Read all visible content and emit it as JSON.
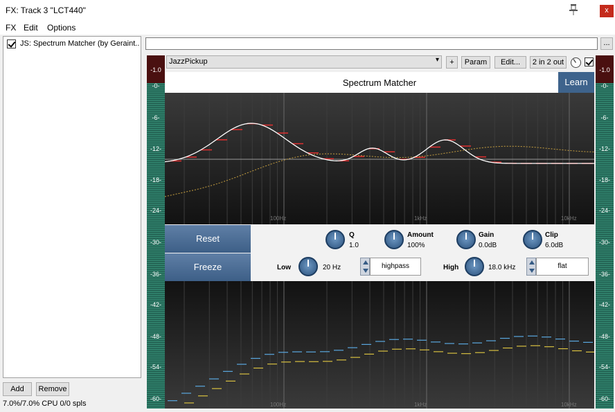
{
  "window": {
    "title": "FX: Track 3 \"LCT440\"",
    "close_glyph": "x"
  },
  "menu": [
    "FX",
    "Edit",
    "Options"
  ],
  "fx_chain": {
    "items": [
      {
        "label": "JS: Spectrum Matcher (by Geraint...",
        "enabled": true
      }
    ]
  },
  "buttons": {
    "add": "Add",
    "remove": "Remove",
    "more": "..."
  },
  "status": "7.0%/7.0% CPU 0/0 spls",
  "toolbar": {
    "preset": "JazzPickup",
    "plus": "+",
    "param": "Param",
    "edit": "Edit...",
    "io": "2 in 2 out"
  },
  "meter_ticks": [
    "-1.0",
    "-0-",
    "-6-",
    "-12-",
    "-18-",
    "-24-",
    "-30-",
    "-36-",
    "-42-",
    "-48-",
    "-54-",
    "-60-"
  ],
  "plugin": {
    "title": "Spectrum Matcher",
    "learn": "Learn",
    "reset": "Reset",
    "freeze": "Freeze",
    "freq_labels": [
      "100Hz",
      "1kHz",
      "10kHz"
    ],
    "controls": {
      "q": {
        "label": "Q",
        "value": "1.0"
      },
      "amount": {
        "label": "Amount",
        "value": "100%"
      },
      "gain": {
        "label": "Gain",
        "value": "0.0dB"
      },
      "clip": {
        "label": "Clip",
        "value": "6.0dB"
      },
      "low": {
        "label": "Low",
        "value": "20 Hz",
        "filter": "highpass"
      },
      "high": {
        "label": "High",
        "value": "18.0 kHz",
        "filter": "flat"
      }
    }
  },
  "colors": {
    "accent": "#3e638c",
    "curve": "#ffffff",
    "target": "#e03030",
    "source": "#c8a040",
    "bars_blue": "#5aa8e0",
    "bars_yellow": "#d8c040"
  }
}
